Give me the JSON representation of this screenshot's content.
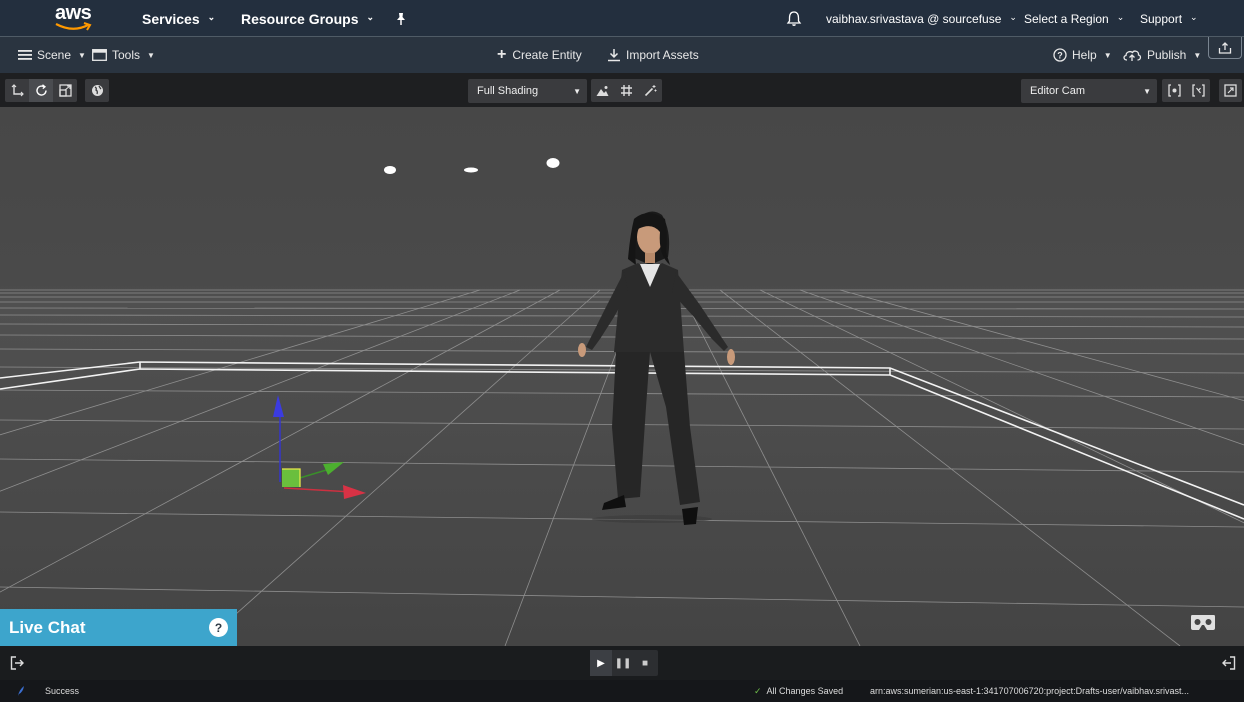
{
  "topbar": {
    "logo": "aws",
    "services": "Services",
    "resource_groups": "Resource Groups",
    "account": "vaibhav.srivastava @ sourcefuse",
    "region": "Select a Region",
    "support": "Support"
  },
  "menubar": {
    "scene": "Scene",
    "tools": "Tools",
    "create_entity": "Create Entity",
    "import_assets": "Import Assets",
    "help": "Help",
    "publish": "Publish"
  },
  "toolbar": {
    "shading": "Full Shading",
    "camera": "Editor Cam"
  },
  "livechat": {
    "label": "Live Chat",
    "help": "?"
  },
  "status": {
    "left": "Success",
    "saved": "All Changes Saved",
    "arn": "arn:aws:sumerian:us-east-1:341707006720:project:Drafts-user/vaibhav.srivast..."
  },
  "colors": {
    "topbar": "#232f3e",
    "accent_livechat": "#3da5cc",
    "saved_check": "#6fbf4a"
  }
}
